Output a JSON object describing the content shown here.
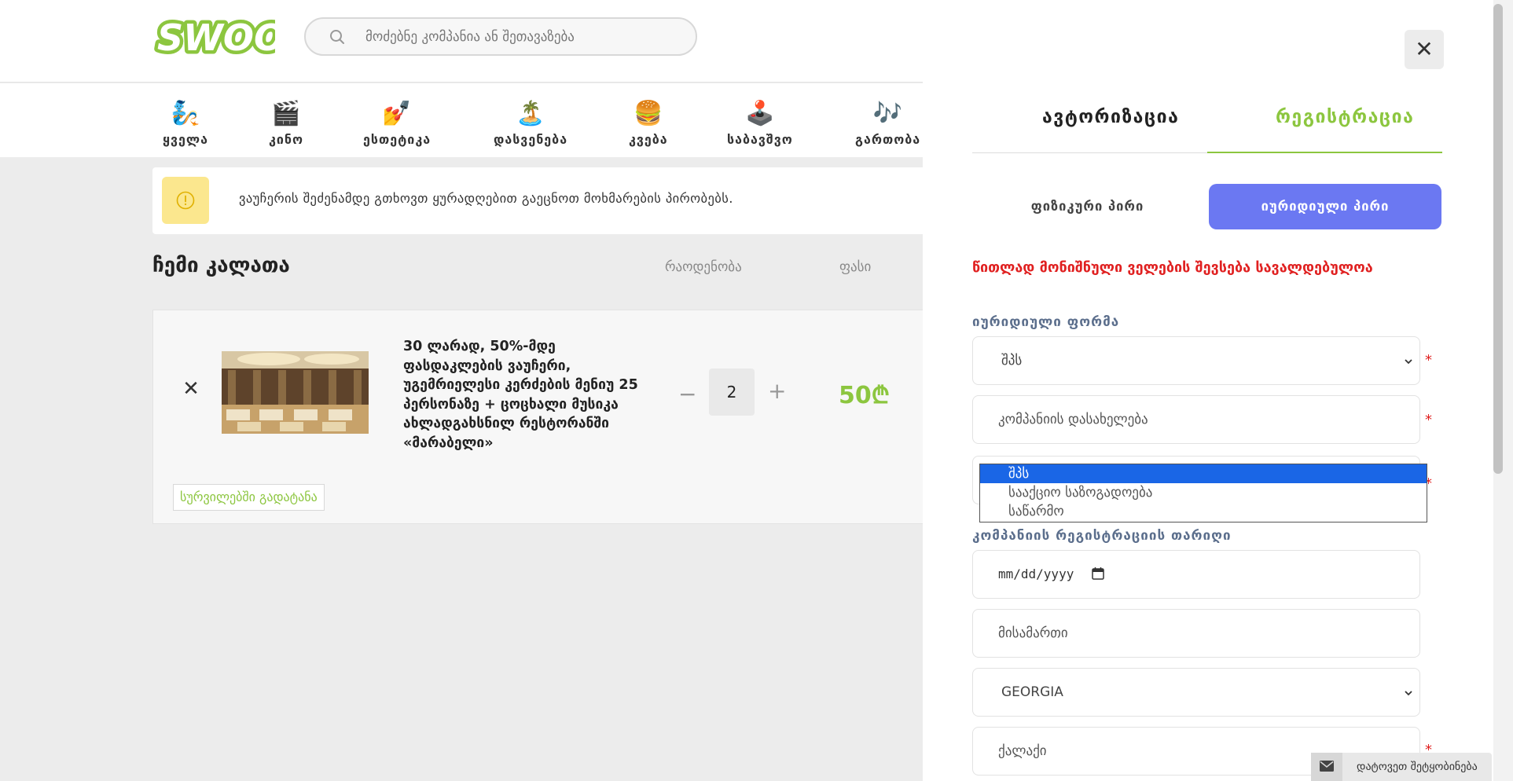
{
  "header": {
    "logo_text": "SWOOP",
    "search_placeholder": "მოძებნე კომპანია ან შეთავაზება"
  },
  "categories": [
    {
      "label": "ყველა",
      "icon": "🧞"
    },
    {
      "label": "კინო",
      "icon": "🎬"
    },
    {
      "label": "ესთეტიკა",
      "icon": "💅"
    },
    {
      "label": "დასვენება",
      "icon": "🏝️"
    },
    {
      "label": "კვება",
      "icon": "🍔"
    },
    {
      "label": "საბავშვო",
      "icon": "🕹️"
    },
    {
      "label": "გართობა",
      "icon": "🎶"
    }
  ],
  "notice": {
    "text": "ვაუჩერის შეძენამდე გთხოვთ ყურადღებით გაეცნოთ მოხმარების პირობებს."
  },
  "cart": {
    "title": "ჩემი კალათა",
    "col_quantity": "რაოდენობა",
    "col_price": "ფასი",
    "item": {
      "title": "30 ლარად, 50%-მდე ფასდაკლების ვაუჩერი, უგემრიელესი კერძების მენიუ 25 პერსონაზე + ცოცხალი მუსიკა ახლადგახსნილ რესტორანში «მარაბელი»",
      "quantity": "2",
      "price": "50₾",
      "minus": "−",
      "plus": "+",
      "remove": "✕"
    },
    "wishlist_button": "სურვილებში გადატანა"
  },
  "panel": {
    "close": "✕",
    "tab_login": "ავტორიზაცია",
    "tab_register": "რეგისტრაცია",
    "seg_physical": "ფიზიკური პირი",
    "seg_legal": "იურიდიული პირი",
    "required_note": "წითლად მონიშნული ველების შევსება სავალდებულოა",
    "legal_form_label": "იურიდიული ფორმა",
    "legal_form_value": "შპს",
    "company_name_placeholder": "კომპანიის დასახელება",
    "dropdown_options": [
      "შპს",
      "სააქციო საზოგადოება",
      "საწარმო"
    ],
    "reg_date_label": "კომპანიის რეგისტრაციის თარიღი",
    "reg_date_placeholder": "mm/dd/yyyy",
    "address_placeholder": "მისამართი",
    "country_value": "GEORGIA",
    "city_placeholder": "ქალაქი",
    "required_mark": "*"
  },
  "message_button": "დატოვეთ შეტყობინება",
  "colors": {
    "brand_green": "#8cc63f",
    "accent_purple": "#6b78f2",
    "required_red": "#e02020"
  }
}
